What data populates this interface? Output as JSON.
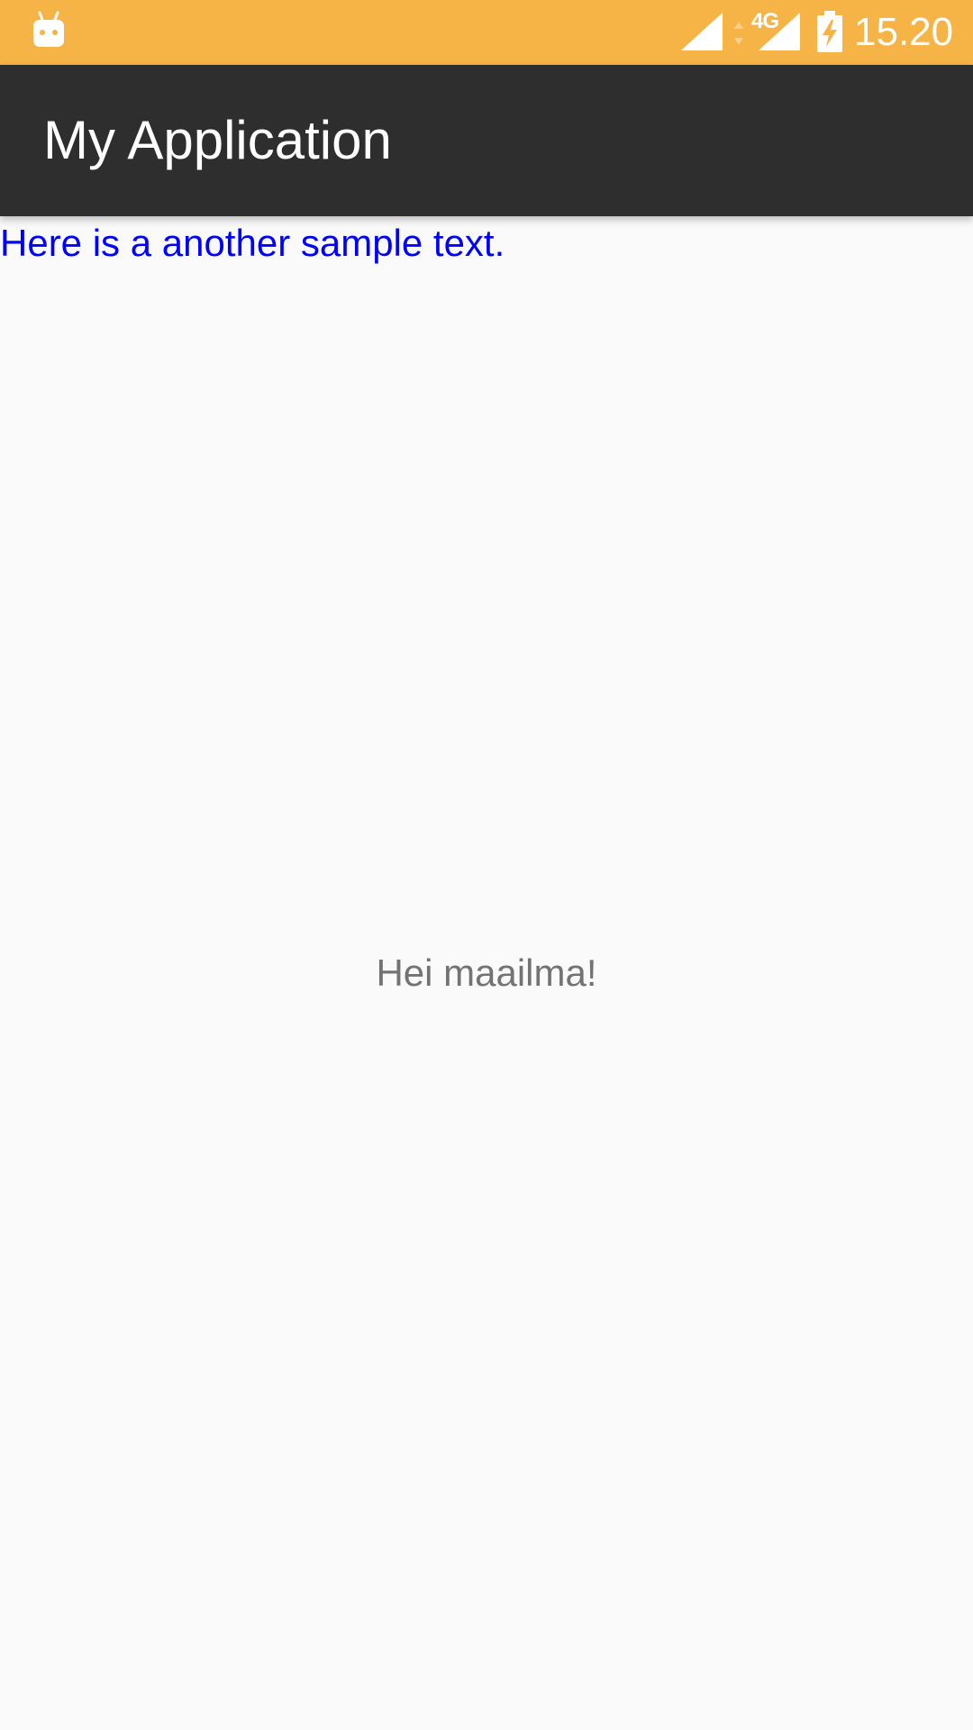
{
  "status_bar": {
    "network_type": "4G",
    "time": "15.20",
    "icons": [
      "android-icon",
      "signal-icon",
      "data-arrows-icon",
      "signal-icon",
      "battery-charging-icon"
    ]
  },
  "app_bar": {
    "title": "My Application"
  },
  "content": {
    "sample_text": "Here is a another sample text.",
    "hello_text": "Hei maailma!"
  },
  "colors": {
    "status_bar": "#f6b346",
    "app_bar": "#2e2e2e",
    "background": "#fafafa",
    "sample_text": "#0000ff",
    "hello_text": "#737373"
  }
}
